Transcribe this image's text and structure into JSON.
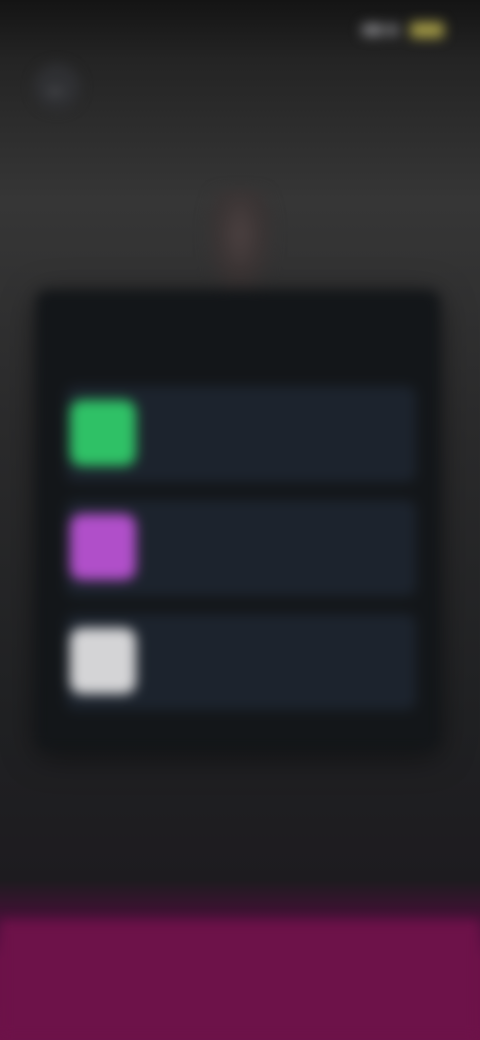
{
  "colors": {
    "accent_orange": "#d5702a",
    "option_green": "#2fc166",
    "option_purple": "#b04fc9",
    "option_white": "#d4d4d6",
    "panel_bg": "#131619",
    "card_bg": "#1c232d",
    "bottom_band": "#6d1249"
  },
  "icons": {
    "back": "arrow-left-icon"
  },
  "statusbar": {
    "time": "",
    "battery_level": 0.8
  },
  "header": {
    "title": ""
  },
  "panel": {
    "title": "",
    "options": [
      {
        "swatch": "#2fc166",
        "label": "",
        "sub": "",
        "meta": ""
      },
      {
        "swatch": "#b04fc9",
        "label": "",
        "sub": "",
        "meta": ""
      },
      {
        "swatch": "#d4d4d6",
        "label": "",
        "sub": "",
        "meta": ""
      }
    ]
  }
}
